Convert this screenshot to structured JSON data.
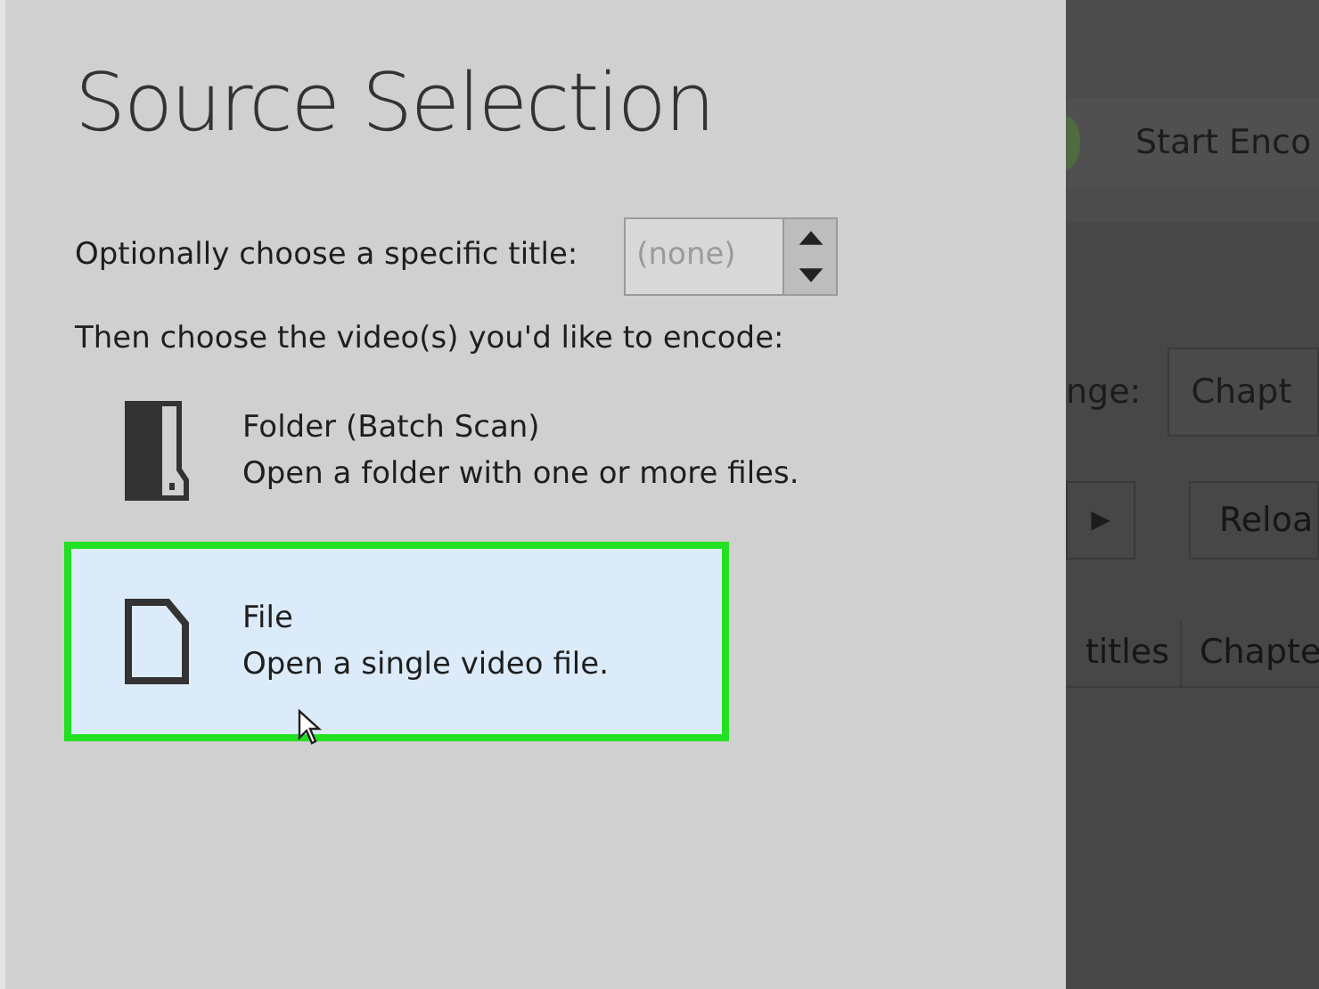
{
  "dialog": {
    "title": "Source Selection",
    "title_prompt": "Optionally choose a specific title:",
    "title_spinner": {
      "value": "(none)"
    },
    "video_prompt": "Then choose the video(s) you'd like to encode:",
    "sources": [
      {
        "kind": "folder",
        "name": "Folder (Batch Scan)",
        "description": "Open a folder with one or more files.",
        "selected": false
      },
      {
        "kind": "file",
        "name": "File",
        "description": "Open a single video file.",
        "selected": true
      }
    ]
  },
  "background_window": {
    "toolbar_button": "Start Enco",
    "range_label": "nge:",
    "range_value": "Chapt",
    "play_button": "▶",
    "reload_button": "Reloa",
    "tabs": [
      "titles",
      "Chapte"
    ]
  }
}
